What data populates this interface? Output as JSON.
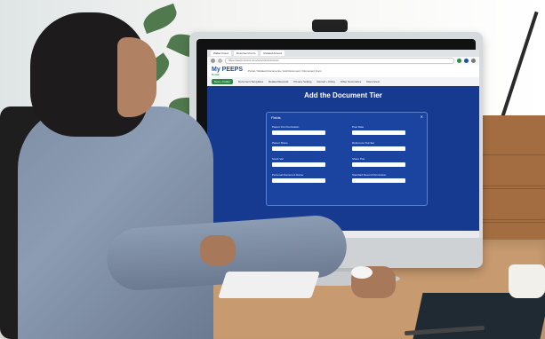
{
  "screen": {
    "browser_tabs": [
      "Wallet Cloud",
      "Document Form",
      "Related Access"
    ],
    "url": "https://www.xxxxxx.com/xxxxx/xxxxx/xxxxx",
    "app_logo": "My PEEPS",
    "app_logo_sub": "Portal",
    "breadcrumb": "Portal / Related Documents / Add Document / Document Form",
    "nav_button": "New + Folder",
    "nav_items": [
      "Document Templates",
      "Related Records",
      "Privacy Setting",
      "Record + Filing",
      "Other Summaries",
      "Disconnect"
    ],
    "page_title": "Add the Document Tier",
    "form_header": "Fields",
    "fields": [
      {
        "label": "Parent Info Permission"
      },
      {
        "label": "Parent Share"
      },
      {
        "label": "Stock Val"
      },
      {
        "label": "Personal Document Name"
      },
      {
        "label": "Post Date"
      },
      {
        "label": "Reference Number"
      },
      {
        "label": "Share Title"
      },
      {
        "label": "Standard Record Permission"
      }
    ]
  },
  "colors": {
    "screen_bg": "#163a8f",
    "form_bg": "#1b44a0",
    "accent_green": "#2e8b47",
    "logo_blue": "#1d4fa8"
  }
}
